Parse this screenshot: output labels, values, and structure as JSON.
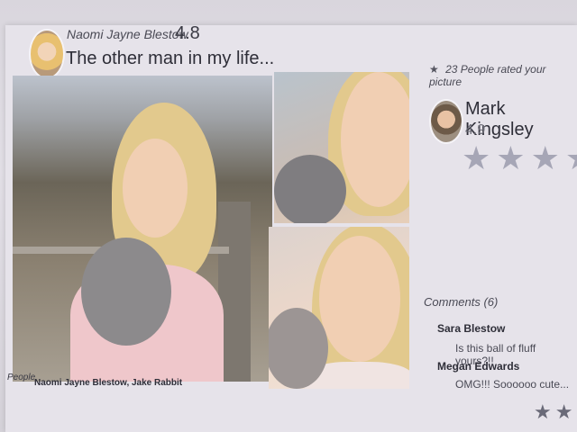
{
  "post": {
    "author_name": "Naomi Jayne Blestow",
    "author_rating": "4.8",
    "caption": "The other man in my life...",
    "people_label": "People",
    "people_names": "Naomi Jayne Blestow, Jake Rabbit"
  },
  "ratings": {
    "rated_text": "23 People rated your picture",
    "reviewer_name": "Mark Kingsley",
    "reviewer_rating": "4.9",
    "star_count_displayed": 4
  },
  "comments": {
    "header": "Comments (6)",
    "items": [
      {
        "author": "Sara Blestow",
        "text": "Is this ball of fluff yours?!!"
      },
      {
        "author": "Megan Edwards",
        "text": "OMG!!! Soooooo cute..."
      }
    ]
  },
  "icons": {
    "star": "star-icon",
    "avatar": "person-avatar"
  },
  "colors": {
    "background": "#e6e3ea",
    "text_primary": "#2e2e38",
    "star_inactive": "#a6a6b6"
  }
}
